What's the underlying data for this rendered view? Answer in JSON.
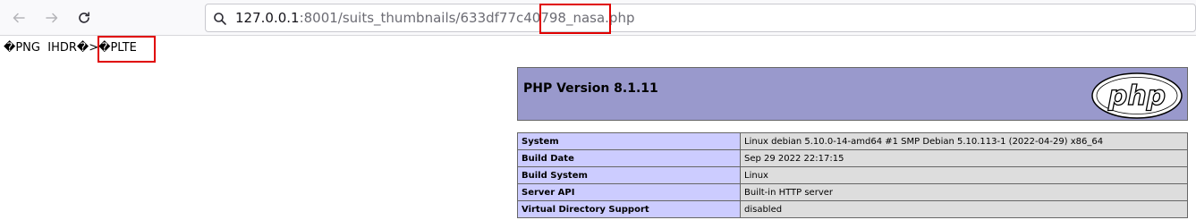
{
  "browser": {
    "url_host": "127.0.0.1",
    "url_rest": ":8001/suits_thumbnails/633df77c40798_nasa.php",
    "back_icon": "arrow-left-icon",
    "forward_icon": "arrow-right-icon",
    "reload_icon": "reload-icon",
    "search_icon": "search-icon"
  },
  "raw_output": {
    "part1": "�PNG  IHDR�>",
    "part2": "�PLTE"
  },
  "phpinfo": {
    "version": "PHP Version 8.1.11",
    "logo_text": "php",
    "colors": {
      "header": "#9999cc",
      "label_cell": "#ccccff",
      "value_cell": "#dddddd"
    },
    "rows": [
      {
        "key": "System",
        "value": "Linux debian 5.10.0-14-amd64 #1 SMP Debian 5.10.113-1 (2022-04-29) x86_64"
      },
      {
        "key": "Build Date",
        "value": "Sep 29 2022 22:17:15"
      },
      {
        "key": "Build System",
        "value": "Linux"
      },
      {
        "key": "Server API",
        "value": "Built-in HTTP server"
      },
      {
        "key": "Virtual Directory Support",
        "value": "disabled"
      }
    ]
  },
  "annotation_color": "#e00000"
}
